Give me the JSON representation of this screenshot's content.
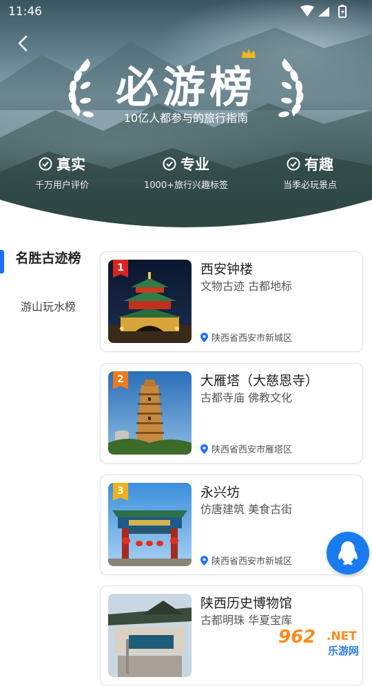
{
  "status_bar": {
    "time": "11:46"
  },
  "header": {
    "title": "必游榜",
    "subtitle": "10亿人都参与的旅行指南",
    "features": [
      {
        "label": "真实",
        "desc": "千万用户评价"
      },
      {
        "label": "专业",
        "desc": "1000+旅行兴趣标签"
      },
      {
        "label": "有趣",
        "desc": "当季必玩景点"
      }
    ]
  },
  "sidebar": {
    "items": [
      {
        "label": "名胜古迹榜",
        "active": true
      },
      {
        "label": "游山玩水榜",
        "active": false
      }
    ]
  },
  "cards": [
    {
      "rank": "1",
      "name": "西安钟楼",
      "tags": "文物古迹 古都地标",
      "location": "陕西省西安市新城区",
      "rank_color": "#d8261f"
    },
    {
      "rank": "2",
      "name": "大雁塔（大慈恩寺）",
      "tags": "古都寺庙 佛教文化",
      "location": "陕西省西安市雁塔区",
      "rank_color": "#f07a1a"
    },
    {
      "rank": "3",
      "name": "永兴坊",
      "tags": "仿唐建筑 美食古街",
      "location": "陕西省西安市新城区",
      "rank_color": "#f0b21a"
    },
    {
      "name": "陕西历史博物馆",
      "tags": "古都明珠 华夏宝库"
    }
  ],
  "watermark": {
    "number": "962",
    "suffix": ".NET",
    "name": "乐游网"
  },
  "colors": {
    "accent": "#1f6dff",
    "qq_button": "#1a7bf0"
  }
}
